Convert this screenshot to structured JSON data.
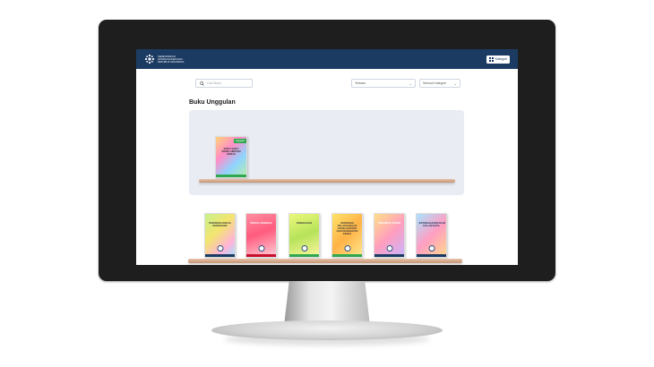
{
  "header": {
    "logo_lines": [
      "KEMENTERIAN",
      "KETENAGAKERJAAN",
      "REPUBLIK INDONESIA"
    ],
    "category_button_label": "Kategori",
    "category_button_icon": "grid-icon",
    "bar_color": "#1c3b63"
  },
  "toolbar": {
    "search_placeholder": "Cari Buku",
    "sort_value": "Terbaru",
    "category_value": "Semua Kategori"
  },
  "featured": {
    "title": "Buku Unggulan",
    "badge": "Unggulan",
    "book_title": "Buku Saku Keselamatan Kerja"
  },
  "books": [
    {
      "title": "Pedoman Kerja Kemnaker"
    },
    {
      "title": "Profil Pekerja"
    },
    {
      "title": "Ringkasan"
    },
    {
      "title": "Pedoman Pelaksanaan Keselamatan dan Kesehatan Kerja"
    },
    {
      "title": "Pedoman Teknis"
    },
    {
      "title": "Ketenagakerjaan dalam Data"
    }
  ]
}
